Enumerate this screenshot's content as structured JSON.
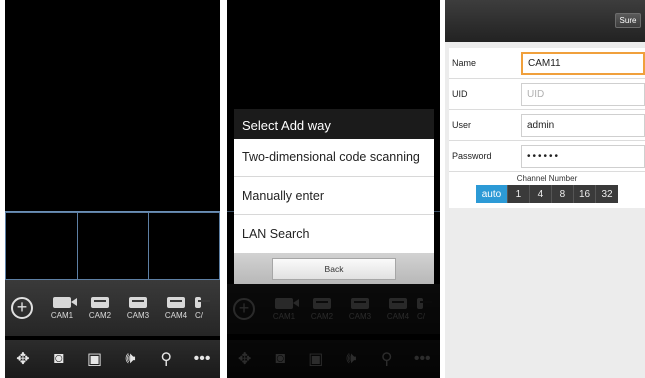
{
  "panel1": {
    "cams": [
      "CAM1",
      "CAM2",
      "CAM3",
      "CAM4",
      "C/"
    ],
    "ctrls": [
      "move-icon",
      "camera-icon",
      "gallery-icon",
      "speaker-icon",
      "microphone-icon",
      "more-icon"
    ]
  },
  "panel2": {
    "cams": [
      "CAM1",
      "CAM2",
      "CAM3",
      "CAM4",
      "C/"
    ],
    "dialog": {
      "title": "Select Add way",
      "items": [
        "Two-dimensional code scanning",
        "Manually enter",
        "LAN Search"
      ],
      "back_label": "Back"
    }
  },
  "panel3": {
    "sure_label": "Sure",
    "fields": [
      {
        "label": "Name",
        "value": "CAM11"
      },
      {
        "label": "UID",
        "value": "",
        "placeholder": "UID"
      },
      {
        "label": "User",
        "value": "admin"
      },
      {
        "label": "Password",
        "value": "••••••"
      }
    ],
    "channel": {
      "label": "Channel Number",
      "options": [
        "auto",
        "1",
        "4",
        "8",
        "16",
        "32"
      ],
      "selected": "auto"
    }
  },
  "colors": {
    "accent": "#2c9ad6",
    "focus": "#f0a03c",
    "grid": "#6b8fb5"
  }
}
